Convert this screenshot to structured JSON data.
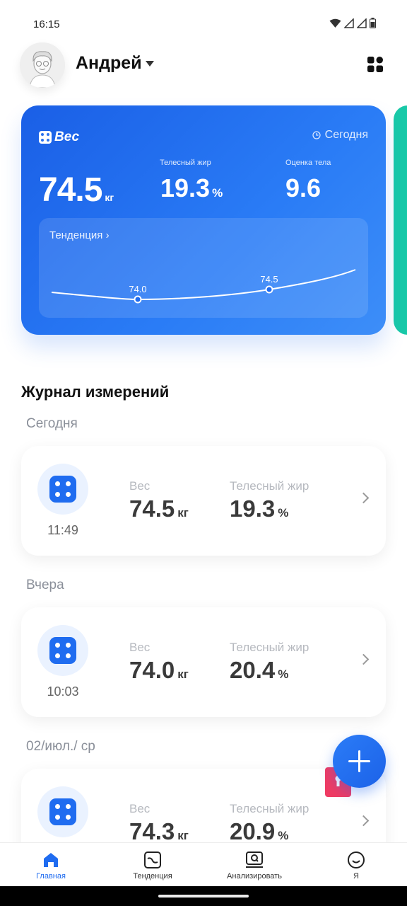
{
  "status_bar": {
    "time": "16:15"
  },
  "header": {
    "user_name": "Андрей"
  },
  "hero": {
    "title": "Вес",
    "date": "Сегодня",
    "weight_value": "74.5",
    "weight_unit": "кг",
    "fat_label": "Телесный жир",
    "fat_value": "19.3",
    "fat_unit": "%",
    "score_label": "Оценка тела",
    "score_value": "9.6",
    "trend_label": "Тенденция",
    "trend_points": [
      {
        "label": "74.0",
        "value": 74.0
      },
      {
        "label": "74.5",
        "value": 74.5
      }
    ]
  },
  "journal": {
    "title": "Журнал измерений",
    "groups": [
      {
        "day": "Сегодня",
        "time": "11:49",
        "weight_label": "Вес",
        "weight": "74.5",
        "weight_unit": "кг",
        "fat_label": "Телесный жир",
        "fat": "19.3",
        "fat_unit": "%"
      },
      {
        "day": "Вчера",
        "time": "10:03",
        "weight_label": "Вес",
        "weight": "74.0",
        "weight_unit": "кг",
        "fat_label": "Телесный жир",
        "fat": "20.4",
        "fat_unit": "%"
      },
      {
        "day": "02/июл./ ср",
        "time": "",
        "weight_label": "Вес",
        "weight": "74.3",
        "weight_unit": "кг",
        "fat_label": "Телесный жир",
        "fat": "20.9",
        "fat_unit": "%"
      }
    ]
  },
  "bottom_nav": [
    {
      "label": "Главная",
      "icon": "home-icon",
      "active": true
    },
    {
      "label": "Тенденция",
      "icon": "trend-icon",
      "active": false
    },
    {
      "label": "Анализировать",
      "icon": "analyze-icon",
      "active": false
    },
    {
      "label": "Я",
      "icon": "profile-icon",
      "active": false
    }
  ],
  "colors": {
    "accent": "#1f6cf0",
    "secondary_card": "#19c9a8",
    "promo": "#ef3b63"
  }
}
